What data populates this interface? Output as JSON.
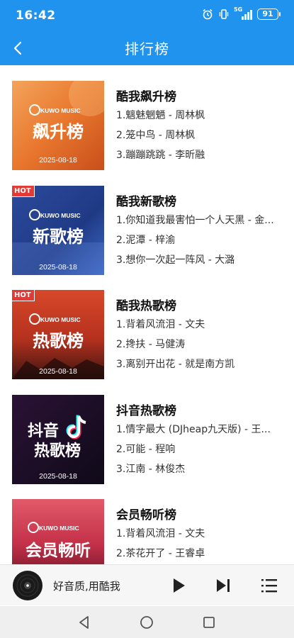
{
  "status": {
    "time": "16:42",
    "network": "5G",
    "battery": "91"
  },
  "header": {
    "title": "排行榜"
  },
  "charts": [
    {
      "name": "酷我飙升榜",
      "cover_brand": "KUWO MUSIC",
      "cover_title": "飙升榜",
      "cover_date": "2025-08-18",
      "badge": "",
      "tracks": [
        "1.魑魅魍魉 - 周林枫",
        "2.笼中鸟 - 周林枫",
        "3.蹦蹦跳跳 - 李昕融"
      ]
    },
    {
      "name": "酷我新歌榜",
      "cover_brand": "KUWO MUSIC",
      "cover_title": "新歌榜",
      "cover_date": "2025-08-18",
      "badge": "HOT",
      "tracks": [
        "1.你知道我最害怕一个人天黑 - 金...",
        "2.泥潭 - 梓渝",
        "3.想你一次起一阵风 - 大潞"
      ]
    },
    {
      "name": "酷我热歌榜",
      "cover_brand": "KUWO MUSIC",
      "cover_title": "热歌榜",
      "cover_date": "2025-08-18",
      "badge": "HOT",
      "tracks": [
        "1.背着风流泪 - 文夫",
        "2.搀扶 - 马健涛",
        "3.离别开出花 - 就是南方凯"
      ]
    },
    {
      "name": "抖音热歌榜",
      "cover_brand": "",
      "cover_title": "抖音热歌榜",
      "cover_title_line1": "抖音",
      "cover_title_line2": "热歌榜",
      "cover_date": "2025-08-18",
      "badge": "",
      "tracks": [
        "1.情字最大 (DJheap九天版) - 王...",
        "2.可能 - 程响",
        "3.江南 - 林俊杰"
      ]
    },
    {
      "name": "会员畅听榜",
      "cover_brand": "KUWO MUSIC",
      "cover_title": "会员畅听",
      "cover_date": "",
      "badge": "",
      "tracks": [
        "1.背着风流泪 - 文夫",
        "2.茶花开了 - 王睿卓",
        ""
      ]
    }
  ],
  "player": {
    "text": "好音质,用酷我"
  },
  "icons": {
    "back": "chevron-left-icon",
    "play": "play-icon",
    "next": "skip-next-icon",
    "playlist": "playlist-icon",
    "nav_back": "nav-back-triangle-icon",
    "nav_home": "nav-home-circle-icon",
    "nav_recent": "nav-recent-square-icon"
  },
  "colors": {
    "primary": "#1f93ee",
    "hot_badge": "#e53935"
  }
}
